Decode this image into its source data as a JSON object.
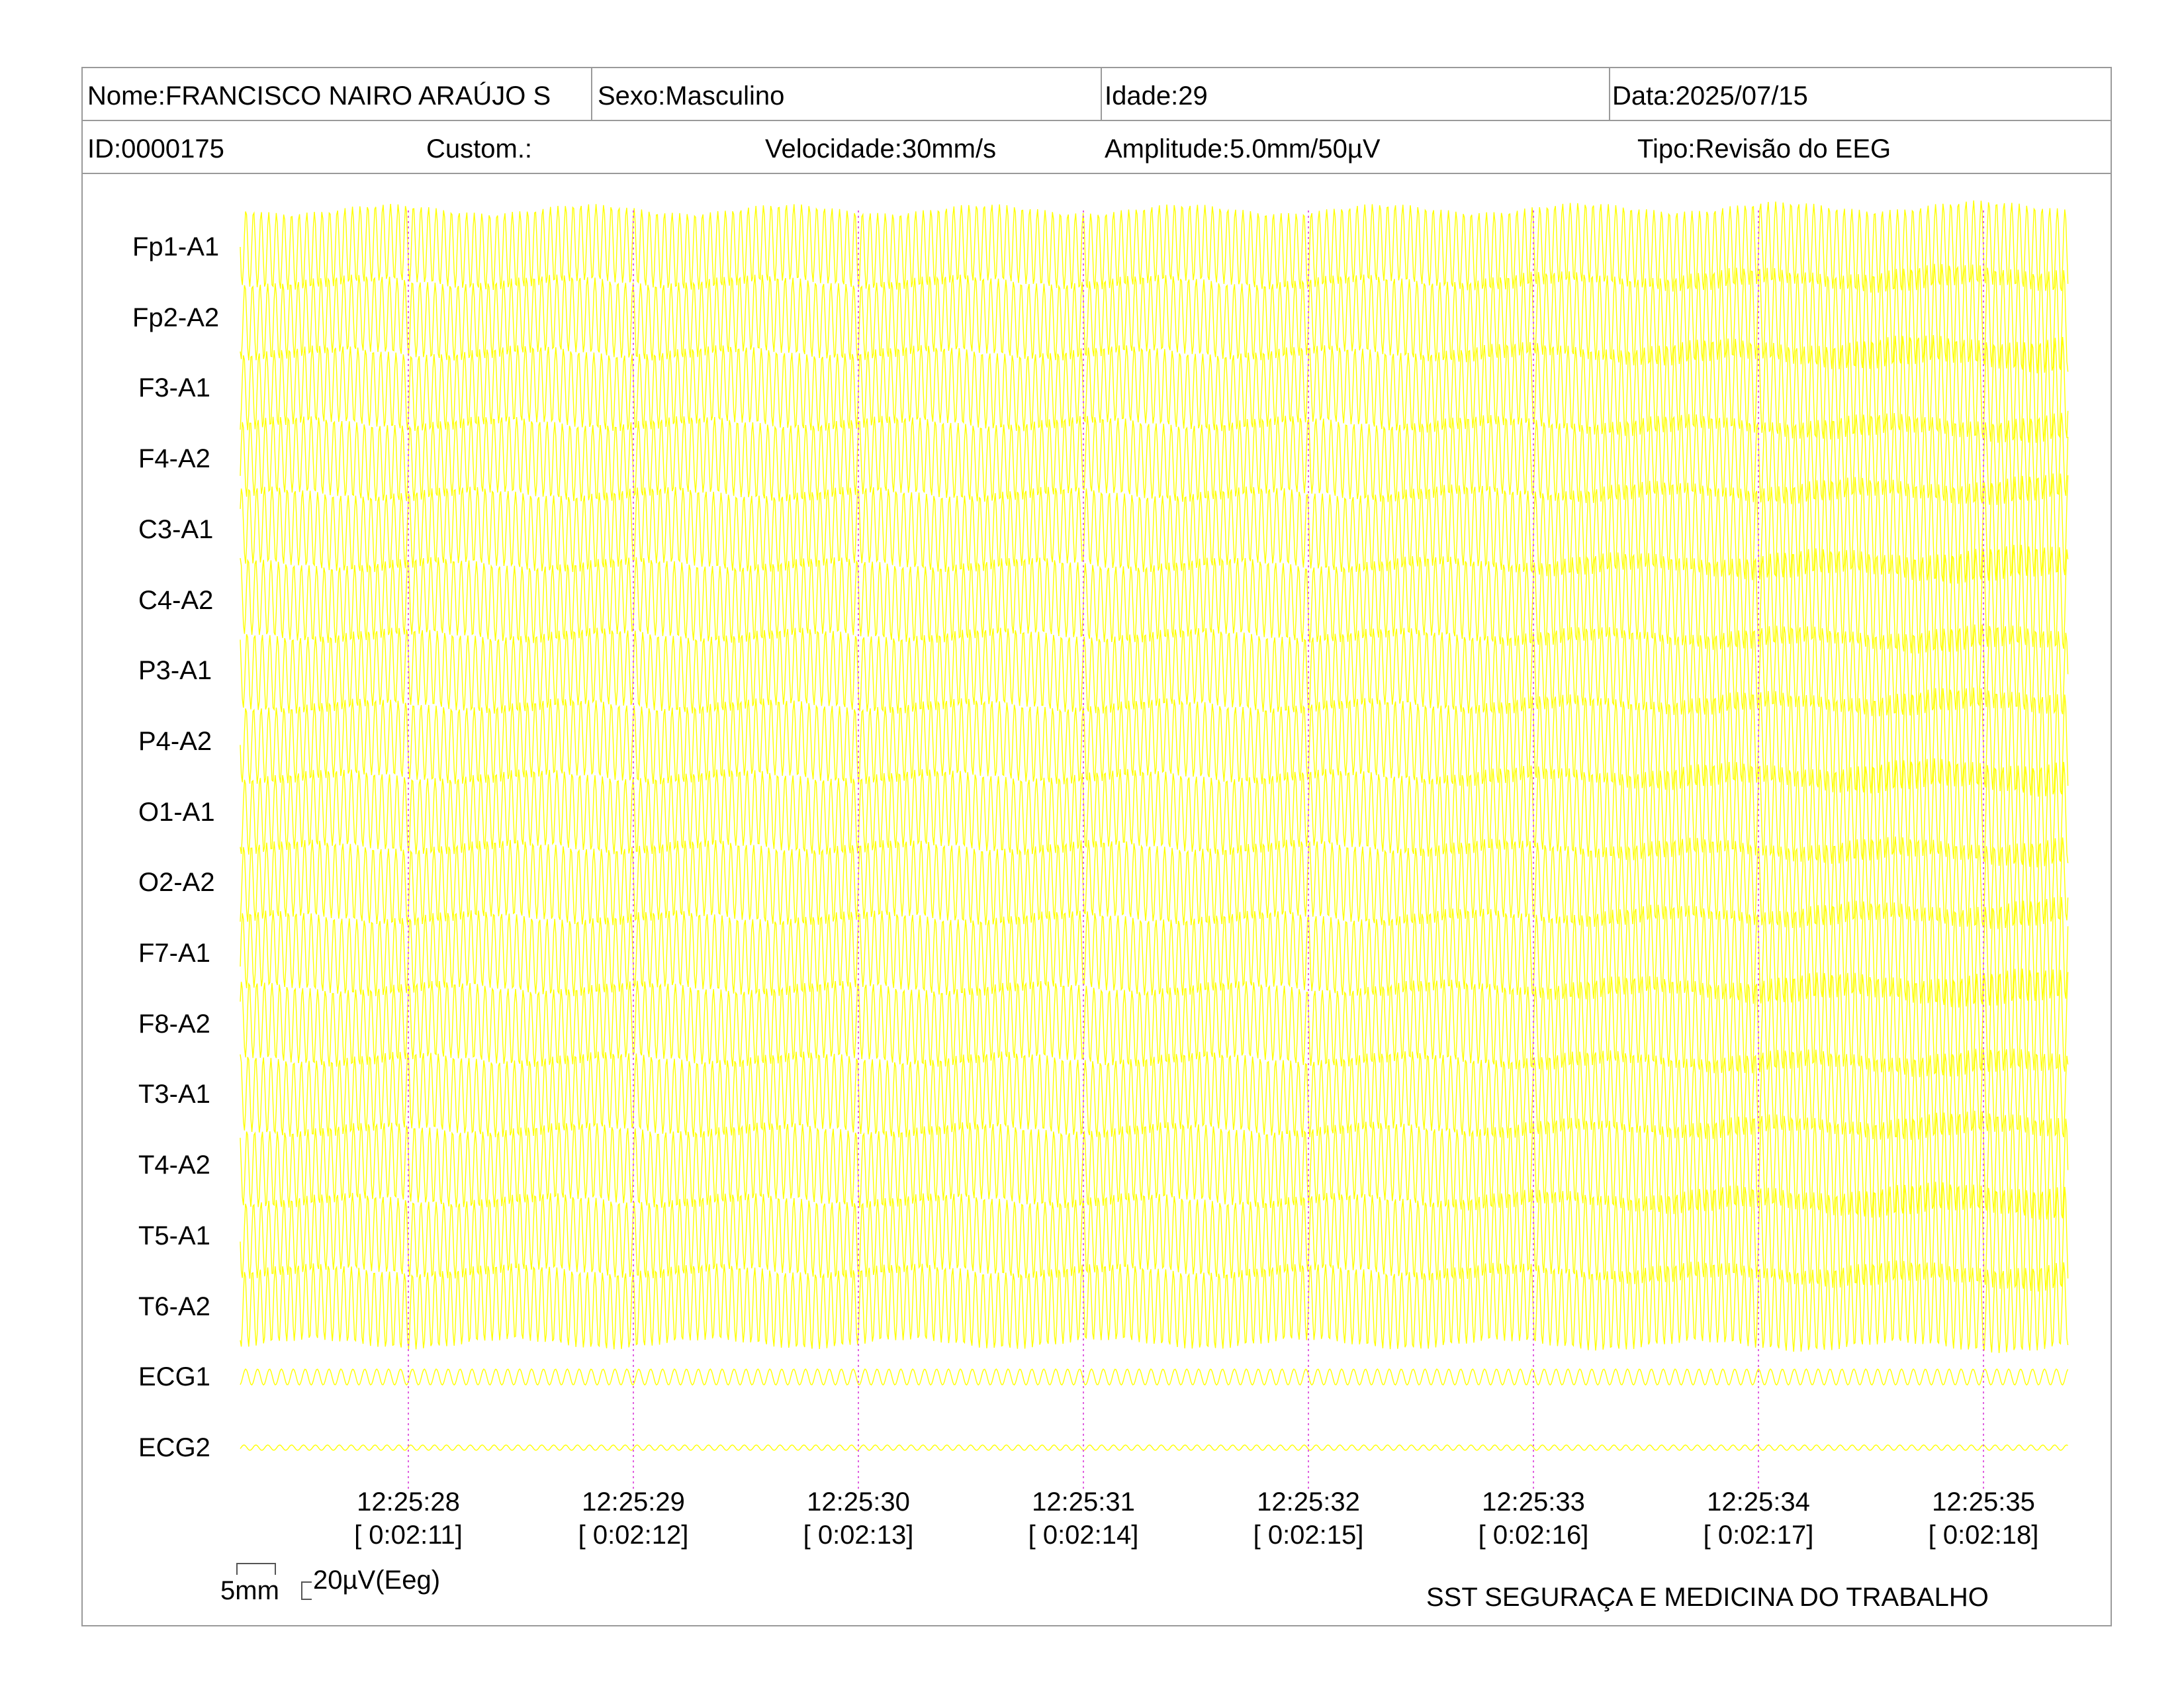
{
  "header": {
    "name_label": "Nome:FRANCISCO NAIRO ARAÚJO S",
    "sex_label": "Sexo:Masculino",
    "age_label": "Idade:29",
    "date_label": "Data:2025/07/15",
    "id_label": "ID:0000175",
    "custom_label": "Custom.:",
    "speed_label": "Velocidade:30mm/s",
    "amplitude_label": "Amplitude:5.0mm/50µV",
    "type_label": "Tipo:Revisão do EEG"
  },
  "channels": [
    "Fp1-A1",
    "Fp2-A2",
    "F3-A1",
    "F4-A2",
    "C3-A1",
    "C4-A2",
    "P3-A1",
    "P4-A2",
    "O1-A1",
    "O2-A2",
    "F7-A1",
    "F8-A2",
    "T3-A1",
    "T4-A2",
    "T5-A1",
    "T6-A2",
    "ECG1",
    "ECG2"
  ],
  "time_marks": [
    {
      "clock": "12:25:28",
      "elapsed": "[ 0:02:11]"
    },
    {
      "clock": "12:25:29",
      "elapsed": "[ 0:02:12]"
    },
    {
      "clock": "12:25:30",
      "elapsed": "[ 0:02:13]"
    },
    {
      "clock": "12:25:31",
      "elapsed": "[ 0:02:14]"
    },
    {
      "clock": "12:25:32",
      "elapsed": "[ 0:02:15]"
    },
    {
      "clock": "12:25:33",
      "elapsed": "[ 0:02:16]"
    },
    {
      "clock": "12:25:34",
      "elapsed": "[ 0:02:17]"
    },
    {
      "clock": "12:25:35",
      "elapsed": "[ 0:02:18]"
    }
  ],
  "scale": {
    "time_label": "5mm",
    "amp_label": "20µV(Eeg)"
  },
  "footer": {
    "company": "SST SEGURAÇA E MEDICINA DO TRABALHO"
  },
  "colors": {
    "trace": "#ffff00",
    "marker": "#e060e0",
    "border": "#9a9a9a"
  }
}
